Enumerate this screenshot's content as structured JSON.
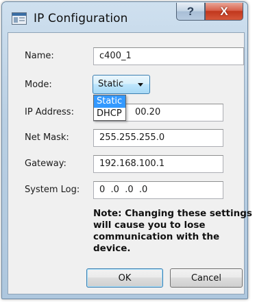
{
  "window": {
    "title": "IP Configuration",
    "help_label": "?",
    "close_label": "X"
  },
  "form": {
    "name": {
      "label": "Name:",
      "value": "c400_1"
    },
    "mode": {
      "label": "Mode:",
      "value": "Static",
      "options": [
        "Static",
        "DHCP"
      ]
    },
    "ip_address": {
      "label": "IP Address:",
      "value": "00.20"
    },
    "net_mask": {
      "label": "Net Mask:",
      "value": "255.255.255.0"
    },
    "gateway": {
      "label": "Gateway:",
      "value": "192.168.100.1"
    },
    "system_log": {
      "label": "System Log:",
      "value": "0  .0  .0  .0"
    }
  },
  "note": "Note: Changing these settings will cause you to lose communication with the device.",
  "buttons": {
    "ok": "OK",
    "cancel": "Cancel"
  },
  "colors": {
    "selection": "#3399ff",
    "close_red": "#c1371d",
    "frame_blue": "#b9cfe3"
  }
}
